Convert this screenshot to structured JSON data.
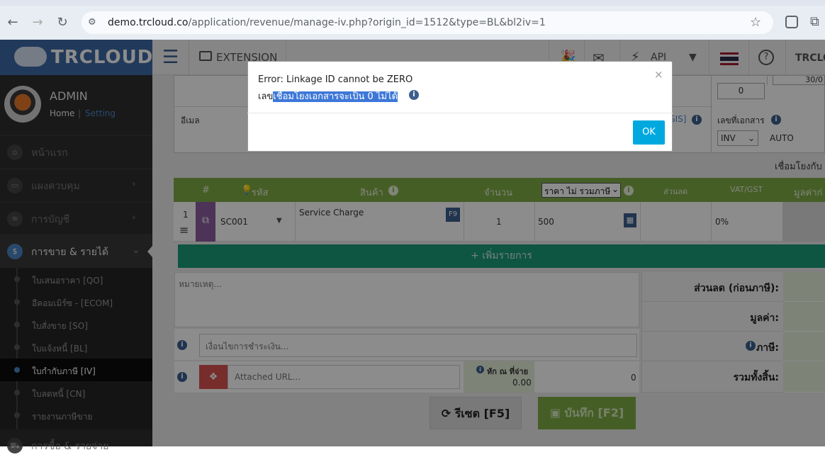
{
  "browser": {
    "url_host": "demo.trcloud.co",
    "url_path": "/application/revenue/manage-iv.php?origin_id=1512&type=BL&bl2iv=1"
  },
  "topbar": {
    "logo_text": "TRCLOUD",
    "extension_label": "EXTENSION",
    "api_label": "API",
    "user_short": "TRCLO",
    "help_label": "?"
  },
  "sidebar": {
    "user_name": "ADMIN",
    "home_link": "Home",
    "setting_link": "Setting",
    "menu": [
      {
        "label": "หน้าแรก"
      },
      {
        "label": "แผงควบคุม"
      },
      {
        "label": "การบัญชี"
      },
      {
        "label": "การขาย & รายได้"
      },
      {
        "label": "การซื้อ & รายจ่าย"
      }
    ],
    "submenu": [
      {
        "label": "ใบเสนอราคา [QO]"
      },
      {
        "label": "อีคอมเมิร์ซ - [ECOM]"
      },
      {
        "label": "ใบสั่งขาย [SO]"
      },
      {
        "label": "ใบแจ้งหนี้ [BL]"
      },
      {
        "label": "ใบกำกับภาษี [IV]"
      },
      {
        "label": "ใบลดหนี้ [CN]"
      },
      {
        "label": "รายงานภาษีขาย"
      }
    ]
  },
  "form": {
    "email_label": "อีเมล",
    "zero_value": "0",
    "date_value": "30/0",
    "doc_no_label": "เลขที่เอกสาร",
    "doc_type": "INV",
    "auto_label": "AUTO",
    "sis_label": "SIS]",
    "linkage_label": "เชื่อมโยงกับ"
  },
  "table": {
    "headers": {
      "num": "#",
      "code": "รหัส",
      "product": "สินค้า",
      "qty": "จำนวน",
      "price_select": "ราคา ไม่ รวมภาษี",
      "discount": "ส่วนลด",
      "vat": "VAT/GST",
      "value": "มูลค่าก่"
    },
    "rows": [
      {
        "num": "1",
        "code": "SC001",
        "description": "Service Charge",
        "f9": "F9",
        "qty": "1",
        "price": "500",
        "vat": "0%"
      }
    ],
    "add_row_label": "+ เพิ่มรายการ"
  },
  "footer_form": {
    "notes_placeholder": "หมายเหตุ...",
    "conditions_placeholder": "เงื่อนไขการชำระเงิน...",
    "attached_url_placeholder": "Attached URL...",
    "wht_label": "หัก ณ ที่จ่าย",
    "wht_value": "0.00",
    "wht_total": "0",
    "totals": {
      "discount_label": "ส่วนลด (ก่อนภาษี):",
      "value_label": "มูลค่า:",
      "tax_label": "ภาษี:",
      "grand_total_label": "รวมทั้งสิ้น:"
    },
    "reset_label": "รีเซต [F5]",
    "save_label": "บันทึก [F2]"
  },
  "modal": {
    "line1": "Error: Linkage ID cannot be ZERO",
    "line2_prefix": "เลข",
    "line2_highlight": "เชื่อมโยงเอกสารจะเป็น 0 ไม่ได้",
    "close_glyph": "×",
    "ok_label": "OK"
  },
  "colors": {
    "brand_blue": "#3c6aa6",
    "table_header_green": "#7fac45",
    "add_row_teal": "#1a9b78",
    "ok_button": "#00a8e0"
  }
}
